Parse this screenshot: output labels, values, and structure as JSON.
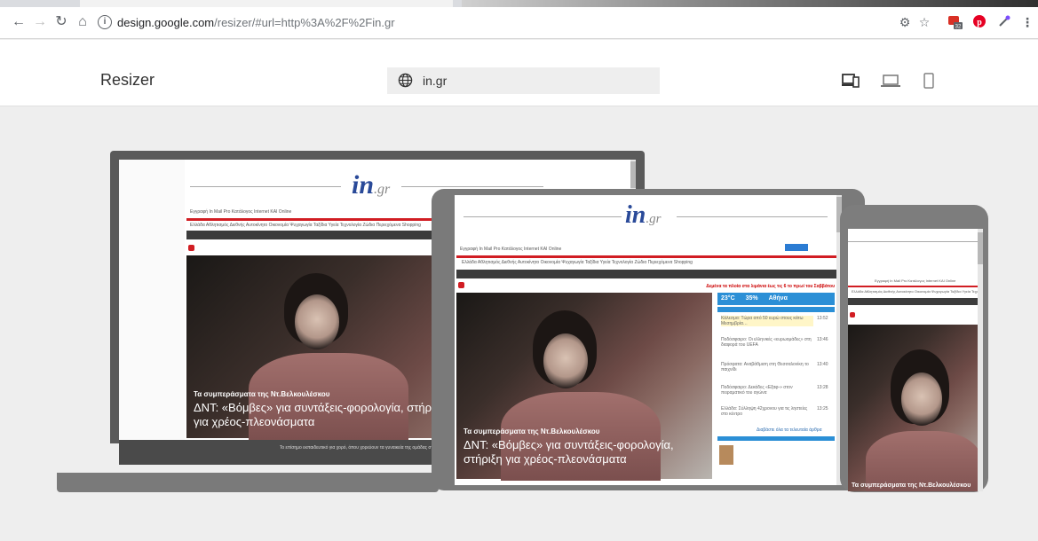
{
  "browser": {
    "url_host": "design.google.com",
    "url_path": "/resizer/#url=http%3A%2F%2Fin.gr",
    "extension_badge": "32"
  },
  "app": {
    "title": "Resizer",
    "url_value": "in.gr"
  },
  "site": {
    "logo_main": "in",
    "logo_suffix": ".gr",
    "headline_small": "Τα συμπεράσματα της Ντ.Βελκουλέσκου",
    "headline_big": "ΔΝΤ: «Βόμβες» για συντάξεις-φορολογία, στήριξη για χρέος-πλεονάσματα",
    "headline_small_phone": "Τα συμπεράσματα της Ντ.Βελκουλέσκου",
    "ticker": "Δεμένα τα πλοία στα λιμάνια έως τις 6 το πρωί του Σαββάτου",
    "weather_temp": "23°C",
    "weather_city": "Αθήνα",
    "weather_hum": "35%",
    "more_news": "Διαβάστε όλα τα τελευταία άρθρα",
    "nav_links": "Ελλάδα  Αθλητισμός  Διεθνής  Αυτοκίνητο  Οικονομία  Ψυχαγωγία  Ταξίδια  Υγεία  Τεχνολογία  Ζώδια  Περιεχόμενα  Shopping",
    "top_links": "Εγγραφή  In Mail Pro  Κατάλογος Internet  ΚΑΙ Online",
    "footer_text": "Το επίσημο εκπαιδευτικό για χορό, όπου χορεύουν τα γυναικεία της ομάδας στη εκδήλωση του in.gr.",
    "news": [
      "Κάλεσμα: Τώρα από 50 ευρώ στους κάτω Μεσημβρία…",
      "Ποδόσφαιρο: Οι ελληνικές «ευρωομάδες» στη διαφορά του UEFA",
      "Πρόσφατα: Αναβάθμιση στη Θεσσαλονίκη το παιχνίδι",
      "Ποδόσφαιρο: Δεκάδες «Εξαφ-» στον πειραματικό του αγώνα",
      "Ελλάδα: Σύλληψη 42χρονου για τις ληστείες στο κέντρο"
    ],
    "news_times": [
      "13:52",
      "13:46",
      "13:40",
      "13:28",
      "13:25"
    ]
  }
}
